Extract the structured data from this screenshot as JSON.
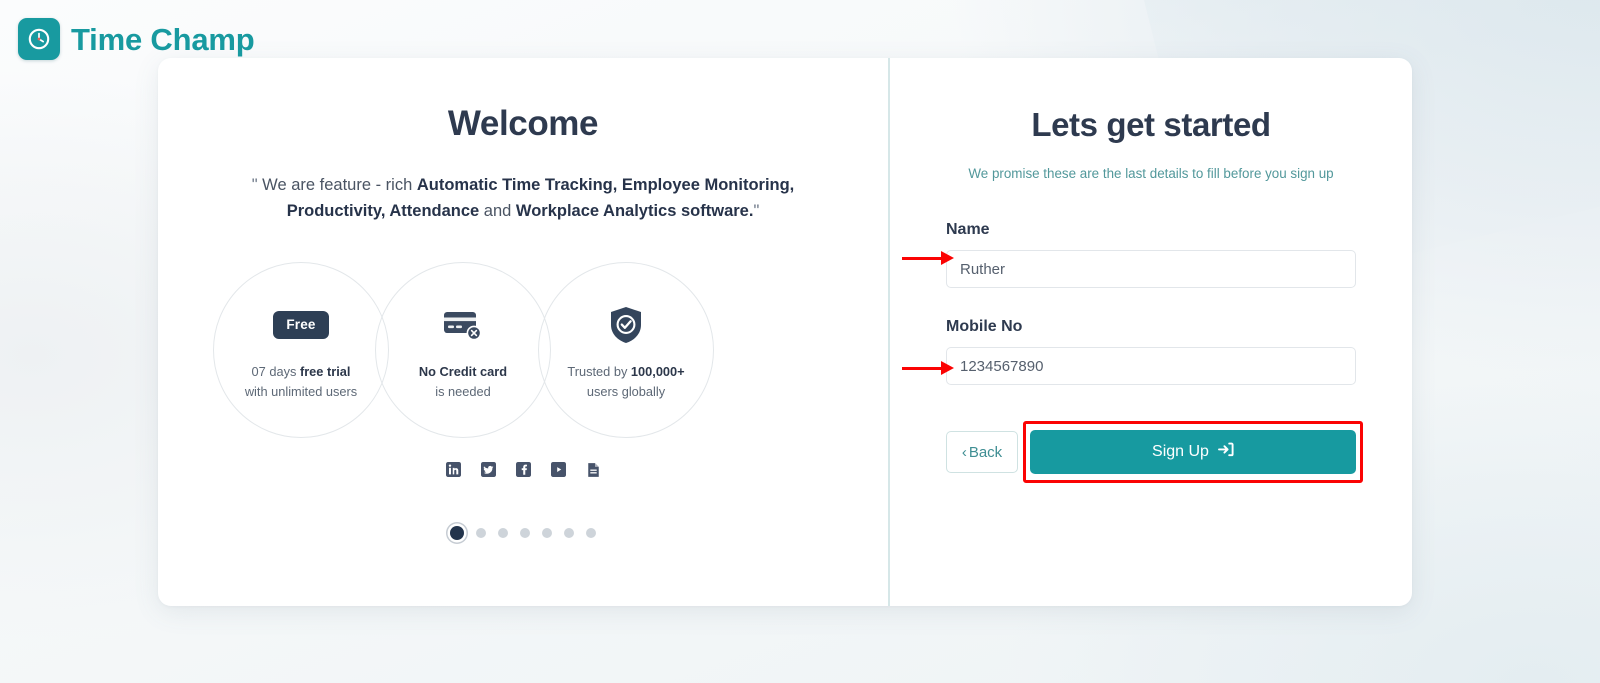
{
  "brand": {
    "name": "Time Champ",
    "icon": "clock-icon",
    "color": "#189aa0"
  },
  "left_pane": {
    "title": "Welcome",
    "quote": {
      "open_quote": "\"",
      "close_quote": "\"",
      "part1": " We are feature - rich ",
      "bold1": "Automatic Time Tracking, Employee Monitoring, Productivity, Attendance",
      "part2": " and ",
      "bold2": "Workplace Analytics software.",
      "full_text": "\" We are feature - rich Automatic Time Tracking, Employee Monitoring, Productivity, Attendance and Workplace Analytics software.\""
    },
    "features": [
      {
        "icon": "free-badge-icon",
        "badge_label": "Free",
        "line1_prefix": "07 days ",
        "line1_bold": "free trial",
        "line2": "with unlimited users"
      },
      {
        "icon": "credit-card-disabled-icon",
        "line1_bold": "No Credit card",
        "line2": "is needed"
      },
      {
        "icon": "shield-check-icon",
        "line1_prefix": "Trusted by ",
        "line1_bold": "100,000+",
        "line2": "users globally"
      }
    ],
    "social": [
      {
        "name": "linkedin-icon",
        "label": "in"
      },
      {
        "name": "twitter-icon",
        "label": ""
      },
      {
        "name": "facebook-icon",
        "label": "f"
      },
      {
        "name": "youtube-icon",
        "label": ""
      },
      {
        "name": "blog-icon",
        "label": ""
      }
    ],
    "carousel": {
      "total_dots": 7,
      "active_index": 0
    }
  },
  "right_pane": {
    "title": "Lets get started",
    "subtitle": "We promise these are the last details to fill before you sign up",
    "subtitle_color": "#52989b",
    "fields": [
      {
        "label": "Name",
        "value": "Ruther",
        "placeholder": "Name"
      },
      {
        "label": "Mobile No",
        "value": "1234567890",
        "placeholder": "Mobile No"
      }
    ],
    "buttons": {
      "back_label": "Back",
      "back_chevron": "‹",
      "signup_label": "Sign Up",
      "signup_icon": "sign-in-arrow-icon",
      "signup_color": "#179aa0"
    },
    "annotation": {
      "color": "#fb0303",
      "target": "sign-up-button"
    }
  }
}
